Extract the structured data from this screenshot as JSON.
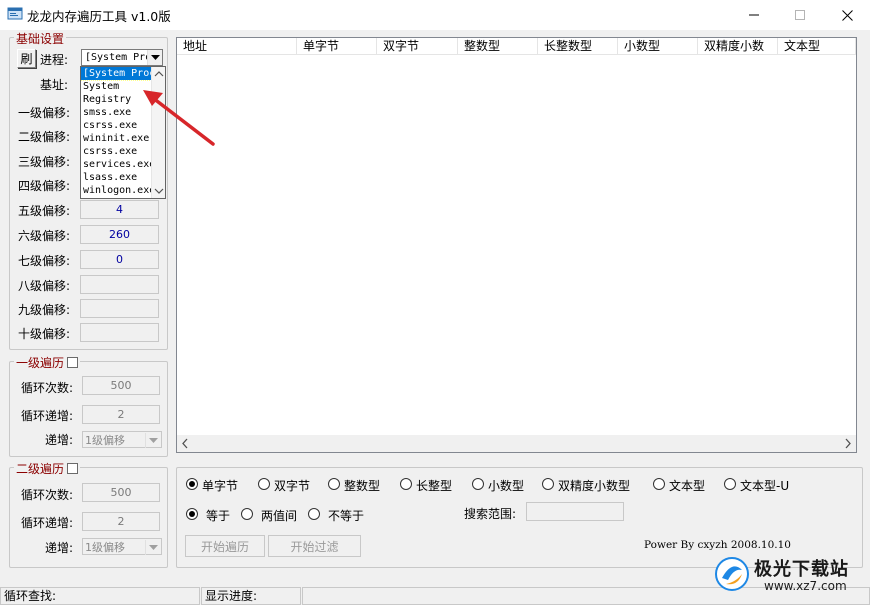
{
  "window": {
    "title": "龙龙内存遍历工具 v1.0版",
    "minimize_icon": "minimize-icon",
    "maximize_icon": "maximize-icon",
    "close_icon": "close-icon"
  },
  "basic": {
    "group_title": "基础设置",
    "refresh_label": "刷",
    "process_label": "进程:",
    "process_value": "[System Process]",
    "process_list": [
      "[System Process]",
      "System",
      "Registry",
      "smss.exe",
      "csrss.exe",
      "wininit.exe",
      "csrss.exe",
      "services.exe",
      "lsass.exe",
      "winlogon.exe"
    ],
    "base_label": "基址:",
    "offsets": [
      {
        "label": "一级偏移:",
        "value": ""
      },
      {
        "label": "二级偏移:",
        "value": ""
      },
      {
        "label": "三级偏移:",
        "value": ""
      },
      {
        "label": "四级偏移:",
        "value": ""
      },
      {
        "label": "五级偏移:",
        "value": "4"
      },
      {
        "label": "六级偏移:",
        "value": "260"
      },
      {
        "label": "七级偏移:",
        "value": "0"
      },
      {
        "label": "八级偏移:",
        "value": ""
      },
      {
        "label": "九级偏移:",
        "value": ""
      },
      {
        "label": "十级偏移:",
        "value": ""
      }
    ]
  },
  "level1": {
    "group_title": "一级遍历",
    "loop_count_label": "循环次数:",
    "loop_count_value": "500",
    "loop_inc_label": "循环递增:",
    "loop_inc_value": "2",
    "inc_label": "递增:",
    "inc_select": "1级偏移"
  },
  "level2": {
    "group_title": "二级遍历",
    "loop_count_label": "循环次数:",
    "loop_count_value": "500",
    "loop_inc_label": "循环递增:",
    "loop_inc_value": "2",
    "inc_label": "递增:",
    "inc_select": "1级偏移"
  },
  "table": {
    "columns": [
      "地址",
      "单字节",
      "双字节",
      "整数型",
      "长整数型",
      "小数型",
      "双精度小数",
      "文本型"
    ]
  },
  "options": {
    "types": [
      {
        "label": "单字节",
        "selected": true
      },
      {
        "label": "双字节",
        "selected": false
      },
      {
        "label": "整数型",
        "selected": false
      },
      {
        "label": "长整型",
        "selected": false
      },
      {
        "label": "小数型",
        "selected": false
      },
      {
        "label": "双精度小数型",
        "selected": false
      },
      {
        "label": "文本型",
        "selected": false
      },
      {
        "label": "文本型-U",
        "selected": false
      }
    ],
    "compare": [
      {
        "label": "等于",
        "selected": true
      },
      {
        "label": "两值间",
        "selected": false
      },
      {
        "label": "不等于",
        "selected": false
      }
    ],
    "search_range_label": "搜索范围:",
    "search_range_value": "",
    "start_traverse": "开始遍历",
    "start_filter": "开始过滤",
    "credit": "Power By cxyzh 2008.10.10"
  },
  "status": {
    "loop_search": "循环查找:",
    "show_progress": "显示进度:"
  },
  "watermark": {
    "text": "极光下载站",
    "url": "www.xz7.com"
  },
  "colors": {
    "selection": "#0078d7",
    "group_title": "#8b0000",
    "annotation_arrow": "#d7262a"
  }
}
